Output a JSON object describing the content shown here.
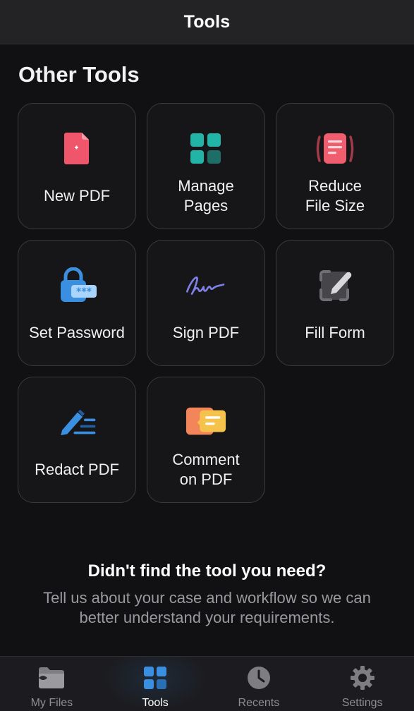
{
  "header": {
    "title": "Tools"
  },
  "section": {
    "title": "Other Tools"
  },
  "tools": [
    {
      "label": "New PDF",
      "icon": "new-pdf-icon"
    },
    {
      "label": "Manage\nPages",
      "icon": "manage-pages-icon"
    },
    {
      "label": "Reduce\nFile Size",
      "icon": "reduce-file-size-icon"
    },
    {
      "label": "Set Password",
      "icon": "lock-icon"
    },
    {
      "label": "Sign PDF",
      "icon": "signature-icon"
    },
    {
      "label": "Fill Form",
      "icon": "fill-form-icon"
    },
    {
      "label": "Redact PDF",
      "icon": "redact-icon"
    },
    {
      "label": "Comment\non PDF",
      "icon": "comment-icon"
    }
  ],
  "help": {
    "title": "Didn't find the tool you need?",
    "text": "Tell us about your case and workflow so we can better understand your requirements."
  },
  "tabbar": {
    "tabs": [
      {
        "label": "My Files",
        "icon": "folder-icon",
        "active": false
      },
      {
        "label": "Tools",
        "icon": "tools-grid-icon",
        "active": true
      },
      {
        "label": "Recents",
        "icon": "clock-icon",
        "active": false
      },
      {
        "label": "Settings",
        "icon": "gear-icon",
        "active": false
      }
    ]
  },
  "colors": {
    "background": "#111113",
    "card_border": "#3a3a3c",
    "accent_blue": "#3a8fe0",
    "new_pdf_red": "#f0566b",
    "manage_teal": "#22b4a6",
    "reduce_red": "#ef5d6e",
    "sign_purple": "#7f7fe6",
    "comment_orange": "#f2855a",
    "comment_yellow": "#f5c34c"
  }
}
